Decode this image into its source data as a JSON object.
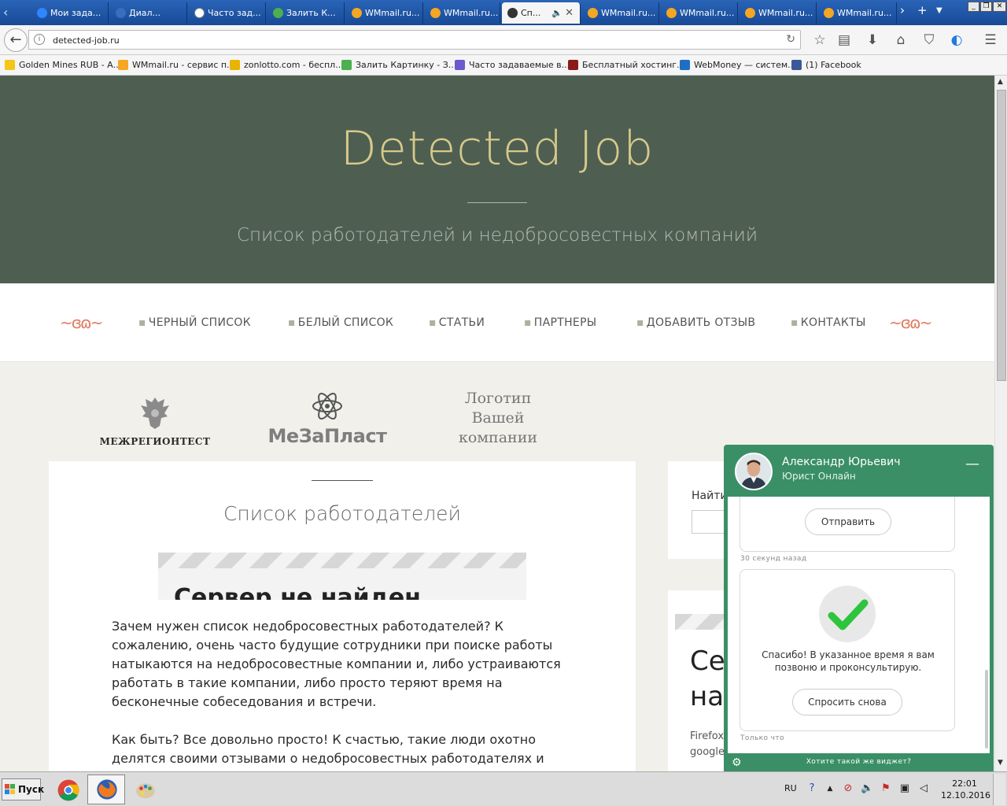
{
  "tabs": [
    {
      "label": "Мои зада...",
      "color": "#2f86ff"
    },
    {
      "label": "Диал...",
      "color": "#3a6cc0"
    },
    {
      "label": "Часто зад...",
      "color": "#ffffff"
    },
    {
      "label": "Залить К...",
      "color": "#4caf50"
    },
    {
      "label": "WMmail.ru...",
      "color": "#f5a623"
    },
    {
      "label": "WMmail.ru...",
      "color": "#f5a623"
    },
    {
      "label": "Сп...",
      "color": "#333333"
    },
    {
      "label": "WMmail.ru...",
      "color": "#f5a623"
    },
    {
      "label": "WMmail.ru...",
      "color": "#f5a623"
    },
    {
      "label": "WMmail.ru...",
      "color": "#f5a623"
    },
    {
      "label": "WMmail.ru...",
      "color": "#f5a623"
    }
  ],
  "address": "detected-job.ru",
  "bookmarks": [
    {
      "label": "Golden Mines RUB - А...",
      "color": "#f5c518"
    },
    {
      "label": "WMmail.ru - сервис п...",
      "color": "#f5a623"
    },
    {
      "label": "zonlotto.com - беспл...",
      "color": "#e8b400"
    },
    {
      "label": "Залить Картинку - З...",
      "color": "#4caf50"
    },
    {
      "label": "Часто задаваемые в...",
      "color": "#6a5acd"
    },
    {
      "label": "Бесплатный хостинг...",
      "color": "#8b1a1a"
    },
    {
      "label": "WebMoney — систем...",
      "color": "#1e6fc4"
    },
    {
      "label": "(1) Facebook",
      "color": "#3b5998"
    }
  ],
  "site": {
    "title": "Detected Job",
    "subtitle": "Список работодателей и недобросовестных компаний",
    "menu": [
      "ЧЕРНЫЙ СПИСОК",
      "БЕЛЫЙ СПИСОК",
      "СТАТЬИ",
      "ПАРТНЕРЫ",
      "ДОБАВИТЬ ОТЗЫВ",
      "КОНТАКТЫ"
    ],
    "logos": {
      "logo1": "МЕЖРЕГИОНТЕСТ",
      "logo2": "МеЗаПласт",
      "logo3": "Логотип Вашей компании"
    },
    "card_title": "Список работодателей",
    "error_text": "Сервер не найден",
    "para1": "Зачем нужен список недобросовестных работодателей? К сожалению, очень часто будущие сотрудники при поиске работы натыкаются на недобросовестные компании и, либо устраиваются работать в такие компании, либо просто теряют время на бесконечные собеседования и встречи.",
    "para2": "Как быть? Все довольно просто! К счастью, такие люди охотно делятся своими отзывами о недобросовестных работодателях и предостерегают",
    "search_label": "Найти",
    "side_big1": "Се",
    "side_big2": "на",
    "side_small1": "Firefox",
    "side_small2": "google"
  },
  "widget": {
    "name": "Александр Юрьевич",
    "role": "Юрист Онлайн",
    "send_button": "Отправить",
    "ts1": "30 секунд назад",
    "thanks": "Спасибо! В указанное время я вам позвоню и проконсультирую.",
    "ask_again": "Спросить снова",
    "ts2": "Только что",
    "cta": "Хотите такой же виджет?"
  },
  "taskbar": {
    "start": "Пуск",
    "lang": "RU",
    "time": "22:01",
    "date": "12.10.2016"
  },
  "colors": {
    "hero_bg": "#4e5f52",
    "hero_title": "#d8c98a",
    "widget_green": "#3a8f66",
    "accent_orange": "#e07a5f"
  }
}
